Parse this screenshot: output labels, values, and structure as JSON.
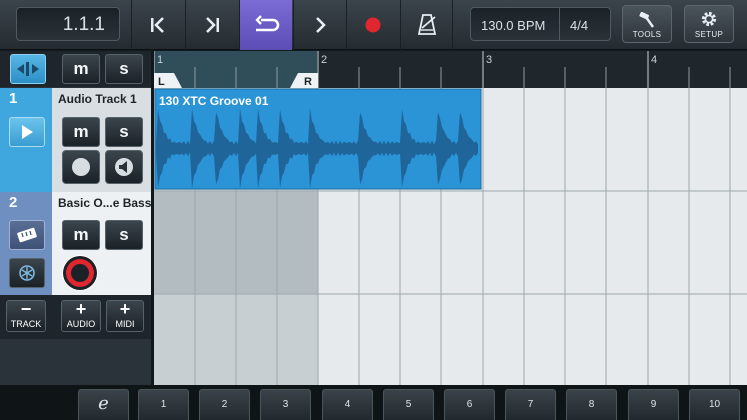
{
  "transport": {
    "position": "1.1.1",
    "tempo": "130.0 BPM",
    "time_signature": "4/4",
    "buttons": [
      {
        "name": "go-to-start",
        "icon": "skip-back-icon"
      },
      {
        "name": "go-to-end",
        "icon": "skip-forward-icon"
      },
      {
        "name": "loop",
        "icon": "loop-icon",
        "active": true
      },
      {
        "name": "play",
        "icon": "play-icon"
      },
      {
        "name": "record",
        "icon": "record-icon"
      },
      {
        "name": "metronome",
        "icon": "metronome-icon"
      }
    ],
    "tools_label": "TOOLS",
    "setup_label": "SETUP"
  },
  "track_controls": {
    "mute_label": "m",
    "solo_label": "s"
  },
  "tracks": [
    {
      "number": "1",
      "name": "Audio Track 1",
      "type": "audio",
      "selected": true
    },
    {
      "number": "2",
      "name": "Basic O...e Bass",
      "type": "instrument",
      "selected": false
    }
  ],
  "track_buttons": {
    "remove_symbol": "−",
    "remove_label": "TRACK",
    "add_audio_symbol": "+",
    "add_audio_label": "AUDIO",
    "add_midi_symbol": "+",
    "add_midi_label": "MIDI"
  },
  "ruler": {
    "bars": [
      "1",
      "2",
      "3",
      "4"
    ],
    "left_locator": "L",
    "right_locator": "R"
  },
  "clip": {
    "name": "130 XTC Groove 01",
    "color": "#2a94d6"
  },
  "keyboard": {
    "edit_label": "e",
    "keys": [
      "1",
      "2",
      "3",
      "4",
      "5",
      "6",
      "7",
      "8",
      "9",
      "10"
    ]
  },
  "colors": {
    "accent_purple": "#6a5cc8",
    "track_blue": "#3fa6de",
    "record_red": "#e0262e"
  }
}
